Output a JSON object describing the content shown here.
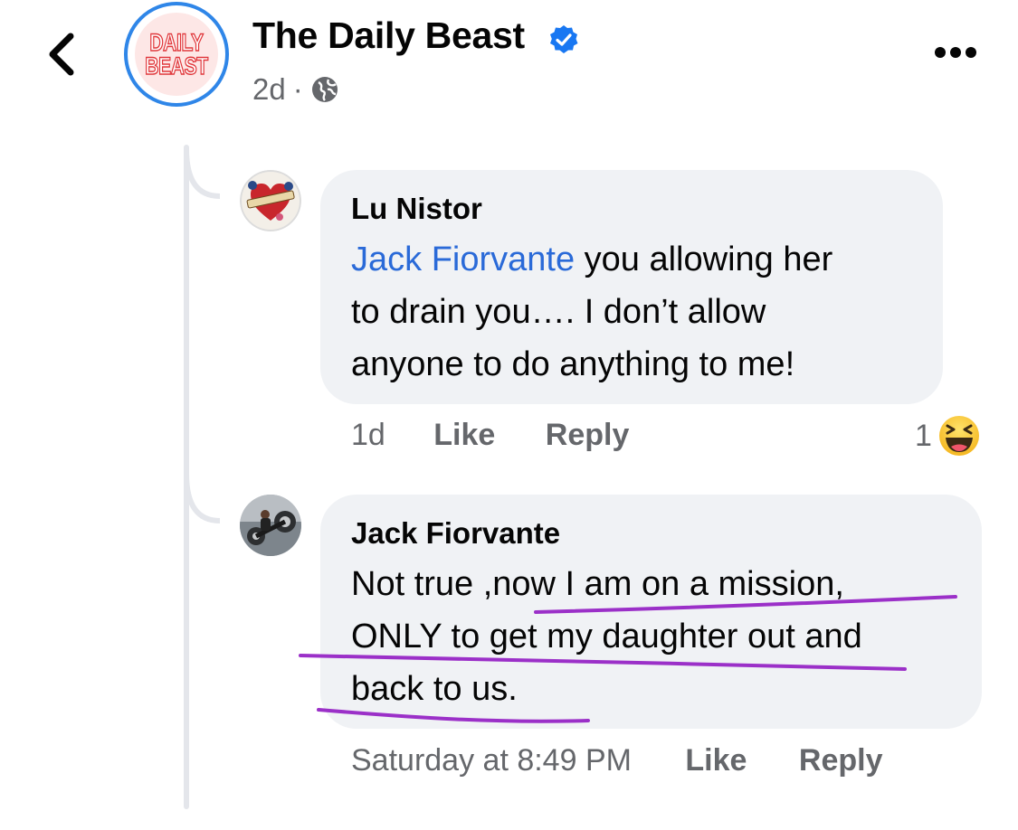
{
  "header": {
    "page_name": "The Daily Beast",
    "logo_text": [
      "DAILY",
      "BEAST"
    ],
    "age": "2d",
    "separator": "·",
    "accent_color": "#2f86e8",
    "icons": {
      "back": "chevron-left-icon",
      "verified": "verified-badge-icon",
      "privacy": "globe-icon",
      "more": "more-options-icon"
    }
  },
  "comments": [
    {
      "author": "Lu Nistor",
      "mention": "Jack Fiorvante",
      "text_lines": [
        " you allowing her",
        "to drain you…. I don’t allow",
        "anyone to do anything to me!"
      ],
      "time": "1d",
      "like_label": "Like",
      "reply_label": "Reply",
      "reaction_count": "1",
      "reaction_icon": "haha-emoji-icon"
    },
    {
      "author": "Jack Fiorvante",
      "text_lines": [
        "Not true ,now I am on a mission,",
        "ONLY to get my daughter out and",
        "back to us."
      ],
      "time": "Saturday at 8:49 PM",
      "like_label": "Like",
      "reply_label": "Reply",
      "highlight_color": "#9b30c8"
    }
  ],
  "colors": {
    "mention": "#2a6ad8",
    "bubble": "#f0f2f5",
    "meta": "#65676b",
    "thread_line": "#e4e6eb"
  }
}
